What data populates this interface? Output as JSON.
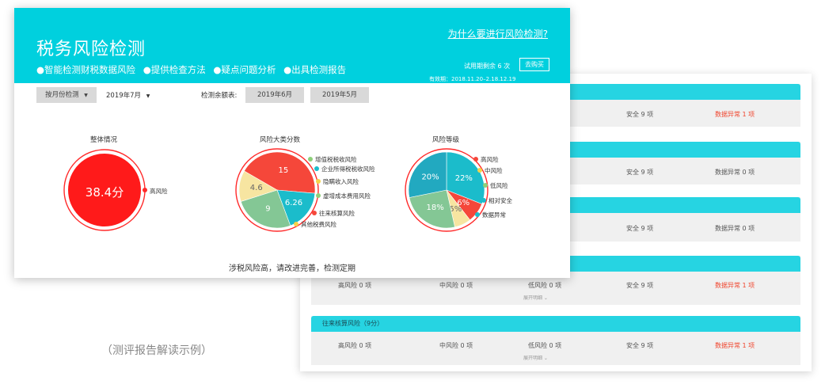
{
  "front": {
    "title": "税务风险检测",
    "features": [
      "●智能检测财税数据风险",
      "●提供检查方法",
      "●疑点问题分析",
      "●出具检测报告"
    ],
    "why_link": "为什么要进行风险检测?",
    "trial_text": "试用期剩余 6 次",
    "buy_button": "去购买",
    "validity": "有效期：2018.11.20–2.18.12.19",
    "toolbar": {
      "mode": "按月份检测",
      "month": "2019年7月",
      "remaining_label": "检测余额表:",
      "jun": "2019年6月",
      "may": "2019年5月"
    },
    "overall": {
      "title": "整体情况",
      "score": "38.4分",
      "level": "高风险",
      "color": "#ff1a1a"
    },
    "conclusion": "涉税风险高，请改进完善，检测定期"
  },
  "chart_data": [
    {
      "type": "pie",
      "title": "风险大类分数",
      "labels": [
        "增值税税收风险",
        "企业所得税税收风险",
        "隐瞒收入风险",
        "虚增成本费用风险",
        "往来核算风险",
        "其他税费风险"
      ],
      "values": [
        15,
        0,
        6.26,
        0,
        9,
        4.6
      ],
      "value_labels": [
        "15",
        "",
        "6.26",
        "",
        "9",
        "4.6"
      ],
      "colors": [
        "#f5473a",
        "#3b7bd4",
        "#1bbccb",
        "#efd35b",
        "#84c795",
        "#f7e5a1"
      ]
    },
    {
      "type": "pie",
      "title": "风险等级",
      "labels": [
        "高风险",
        "中风险",
        "低风险",
        "相对安全",
        "数据异常"
      ],
      "values": [
        0,
        22,
        0,
        6,
        5,
        18,
        20
      ],
      "value_labels": [
        "",
        "22%",
        "",
        "6%",
        "5%",
        "18%",
        "20%"
      ],
      "legend": [
        "高风险",
        "中风险",
        "低风险",
        "相对安全",
        "数据异常"
      ],
      "colors": [
        "#f5473a",
        "#1bbccb",
        "#efd35b",
        "#f5473a",
        "#f7e5a1",
        "#84c795",
        "#22a9c0"
      ]
    }
  ],
  "pie1_legend_colors": [
    "#8ed07a",
    "#1bbccb",
    "#f5d34a",
    "#8ed07a",
    "#f5473a",
    "#f5d34a"
  ],
  "pie2_legend_colors": [
    "#f5473a",
    "#f5d34a",
    "#8ed07a",
    "#1bbccb",
    "#1bbccb"
  ],
  "back": {
    "sections": [
      {
        "head": "",
        "items": [
          "安全 9 项",
          "数据异常 1 项"
        ]
      },
      {
        "head": "",
        "items": [
          "安全 9 项",
          "数据异常 0 项"
        ]
      },
      {
        "head": "",
        "items": [
          "安全 9 项",
          "数据异常 0 项"
        ]
      },
      {
        "head": "",
        "items": [
          "高风险 0 项",
          "中风险 0 项",
          "低风险 0 项",
          "安全 9 项",
          "数据异常 1 项"
        ],
        "expand": "展开明细 ⌄"
      },
      {
        "head": "往来核算风险（9分）",
        "items": [
          "高风险 0 项",
          "中风险 0 项",
          "低风险 0 项",
          "安全 9 项",
          "数据异常 1 项"
        ],
        "expand": "展开明细 ⌄"
      }
    ]
  },
  "caption": "（测评报告解读示例）"
}
